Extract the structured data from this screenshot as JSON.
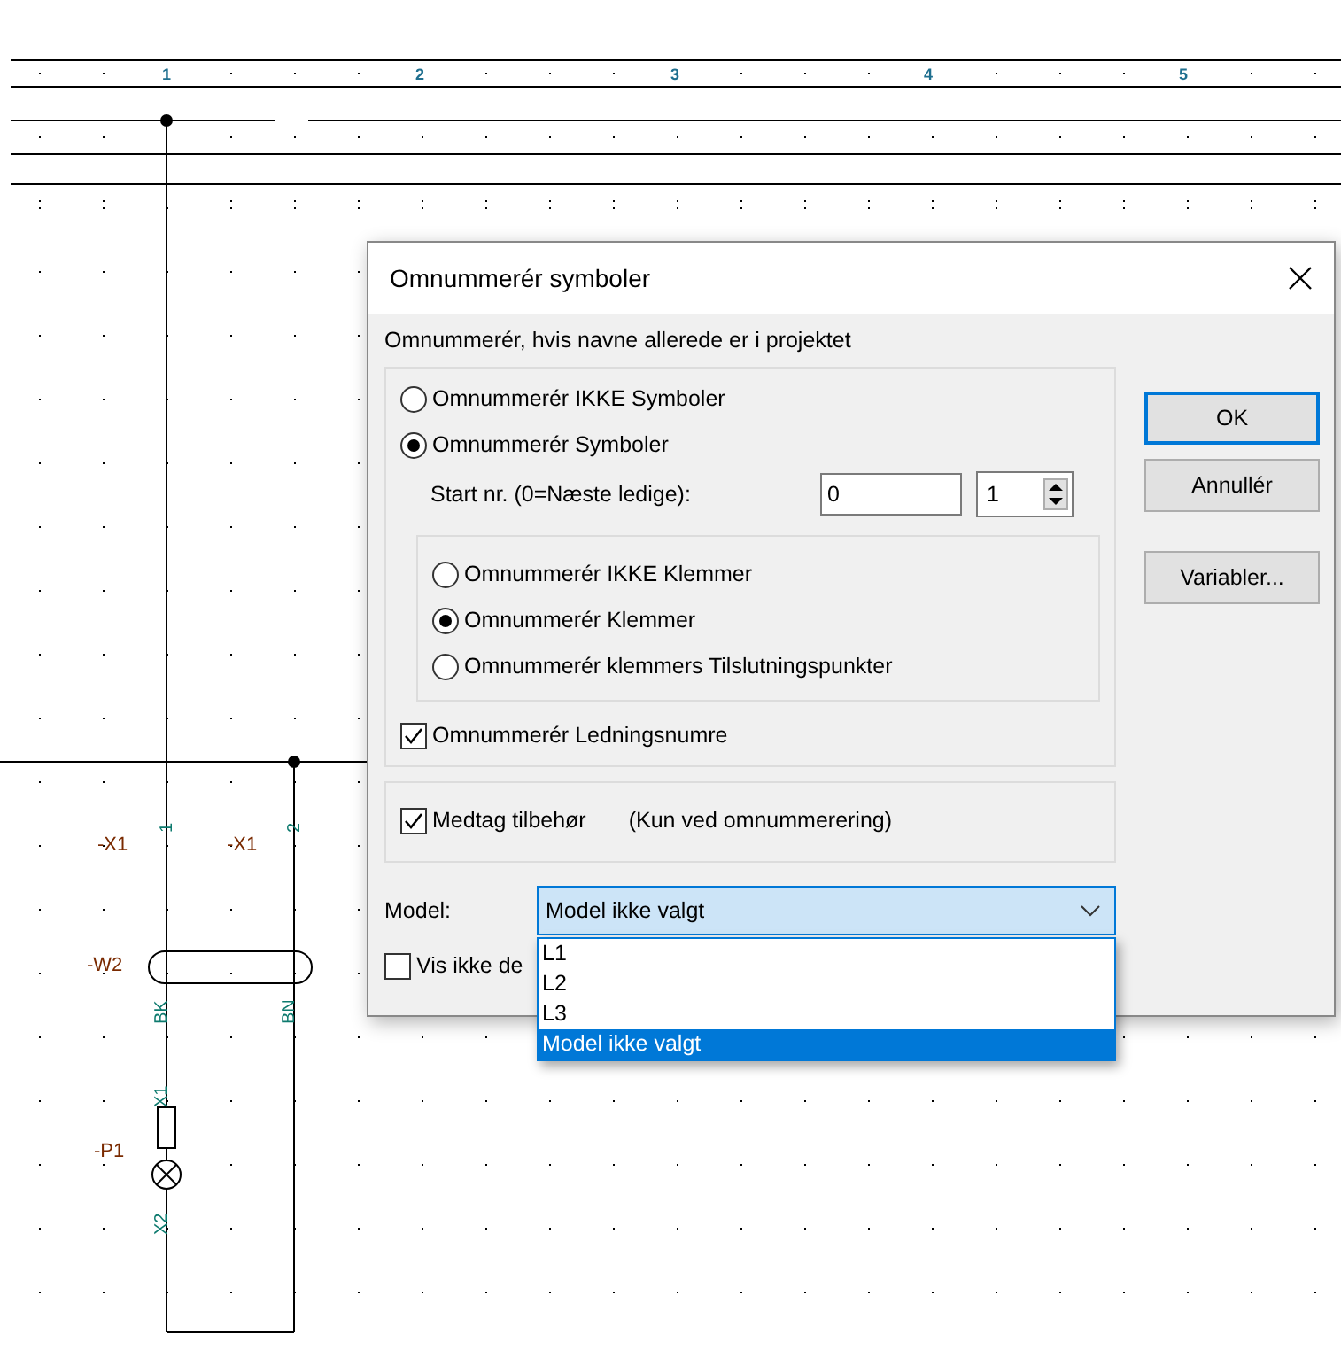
{
  "schematic": {
    "column_numbers": [
      "1",
      "2",
      "3",
      "4",
      "5"
    ],
    "device_labels": [
      {
        "text": "-X1"
      },
      {
        "text": "-X1"
      },
      {
        "text": "-W2"
      },
      {
        "text": "-P1"
      }
    ],
    "terminal_labels": [
      {
        "text": "1"
      },
      {
        "text": "2"
      },
      {
        "text": "BK"
      },
      {
        "text": "BN"
      },
      {
        "text": "X1"
      },
      {
        "text": "X2"
      }
    ]
  },
  "dialog": {
    "title": "Omnummerér symboler",
    "heading": "Omnummerér, hvis navne allerede er i projektet",
    "symbol_options": [
      {
        "label": "Omnummerér IKKE Symboler",
        "selected": false
      },
      {
        "label": "Omnummerér Symboler",
        "selected": true
      }
    ],
    "start": {
      "label": "Start nr. (0=Næste ledige):",
      "value": "0",
      "step": "1"
    },
    "terminal_options": [
      {
        "label": "Omnummerér IKKE Klemmer",
        "selected": false
      },
      {
        "label": "Omnummerér Klemmer",
        "selected": true
      },
      {
        "label": "Omnummerér klemmers Tilslutningspunkter",
        "selected": false
      }
    ],
    "wire_numbers": {
      "label": "Omnummerér Ledningsnumre",
      "checked": true
    },
    "accessories": {
      "label": "Medtag tilbehør",
      "checked": true,
      "note": "(Kun ved omnummerering)"
    },
    "model": {
      "label": "Model:",
      "value": "Model ikke valgt",
      "expanded": true,
      "options": [
        {
          "label": "L1",
          "selected": false
        },
        {
          "label": "L2",
          "selected": false
        },
        {
          "label": "L3",
          "selected": false
        },
        {
          "label": "Model ikke valgt",
          "selected": true
        }
      ]
    },
    "hide_option": {
      "label": "Vis ikke de",
      "checked": false
    },
    "buttons": [
      {
        "label": "OK",
        "default": true
      },
      {
        "label": "Annullér",
        "default": false
      },
      {
        "label": "Variabler...",
        "default": false
      }
    ]
  }
}
